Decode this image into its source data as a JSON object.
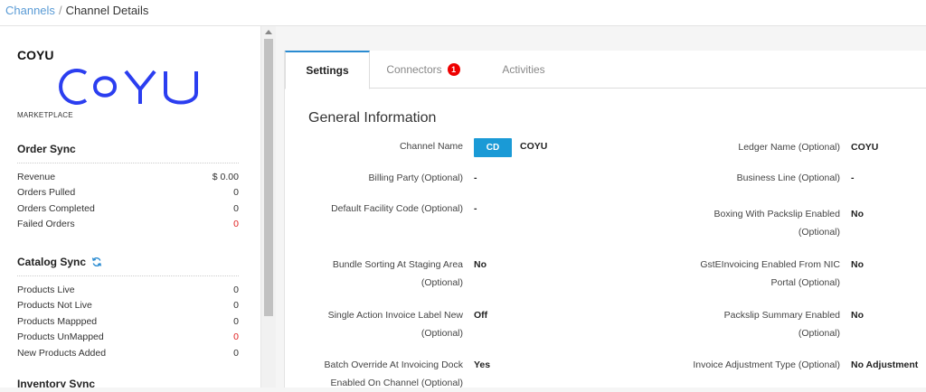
{
  "breadcrumb": {
    "root": "Channels",
    "separator": "/",
    "current": "Channel Details"
  },
  "sidebar": {
    "name": "COYU",
    "logo_text": "COYU",
    "type": "MARKETPLACE",
    "order_sync": {
      "title": "Order Sync",
      "rows": [
        {
          "label": "Revenue",
          "value": "$ 0.00"
        },
        {
          "label": "Orders Pulled",
          "value": "0"
        },
        {
          "label": "Orders Completed",
          "value": "0"
        },
        {
          "label": "Failed Orders",
          "value": "0"
        }
      ]
    },
    "catalog_sync": {
      "title": "Catalog Sync",
      "rows": [
        {
          "label": "Products Live",
          "value": "0"
        },
        {
          "label": "Products Not Live",
          "value": "0"
        },
        {
          "label": "Products Mappped",
          "value": "0"
        },
        {
          "label": "Products UnMapped",
          "value": "0"
        },
        {
          "label": "New Products Added",
          "value": "0"
        }
      ]
    },
    "inventory_sync": {
      "title": "Inventory Sync"
    }
  },
  "tabs": [
    {
      "label": "Settings"
    },
    {
      "label": "Connectors",
      "badge": "1"
    },
    {
      "label": "Activities"
    }
  ],
  "general": {
    "title": "General Information",
    "channel_name": {
      "label": "Channel Name",
      "code": "CD",
      "value": "COYU"
    },
    "ledger_name": {
      "label": "Ledger Name (Optional)",
      "value": "COYU"
    },
    "billing_party": {
      "label": "Billing Party (Optional)",
      "value": "-"
    },
    "business_line": {
      "label": "Business Line (Optional)",
      "value": "-"
    },
    "default_facility": {
      "label": "Default Facility Code (Optional)",
      "value": "-"
    },
    "boxing_packslip": {
      "label1": "Boxing With Packslip Enabled",
      "label2": "(Optional)",
      "value": "No"
    },
    "bundle_sorting": {
      "label1": "Bundle Sorting At Staging Area",
      "label2": "(Optional)",
      "value": "No"
    },
    "gst_einvoicing": {
      "label1": "GstEInvoicing Enabled From NIC",
      "label2": "Portal (Optional)",
      "value": "No"
    },
    "single_action": {
      "label1": "Single Action Invoice Label New",
      "label2": "(Optional)",
      "value": "Off"
    },
    "packslip_summary": {
      "label1": "Packslip Summary Enabled",
      "label2": "(Optional)",
      "value": "No"
    },
    "batch_override": {
      "label1": "Batch Override At Invoicing Dock",
      "label2": "Enabled On Channel (Optional)",
      "value": "Yes"
    },
    "invoice_adjustment": {
      "label": "Invoice Adjustment Type (Optional)",
      "value": "No Adjustment"
    }
  }
}
